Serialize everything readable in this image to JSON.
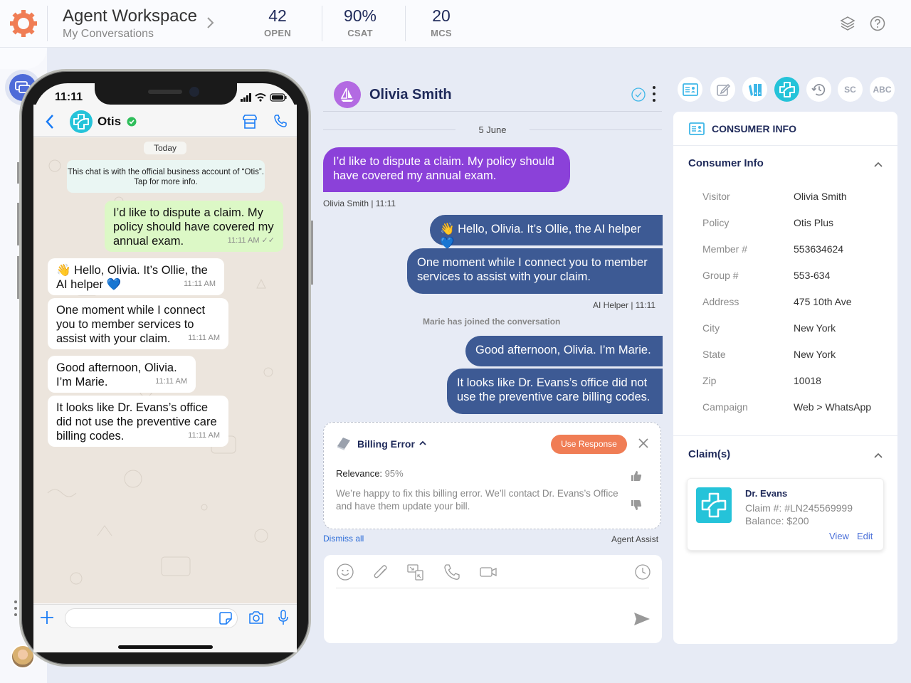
{
  "header": {
    "title": "Agent Workspace",
    "subtitle": "My Conversations",
    "stats": [
      {
        "value": "42",
        "label": "OPEN"
      },
      {
        "value": "90%",
        "label": "CSAT"
      },
      {
        "value": "20",
        "label": "MCS"
      }
    ],
    "icons": [
      "layers-icon",
      "help-icon"
    ]
  },
  "colors": {
    "brand_orange": "#f07d55",
    "customer_bubble": "#8b41d9",
    "agent_bubble": "#3d5a94",
    "accent_teal": "#25c3d9",
    "nav_active": "#4e6bd8"
  },
  "phone": {
    "status_time": "11:11",
    "contact_name": "Otis",
    "date_chip": "Today",
    "business_notice": "This chat is with the official business account of “Otis”. Tap for more info.",
    "messages": [
      {
        "direction": "out",
        "text": "I’d like to dispute a claim. My policy should have covered my annual exam.",
        "time": "11:11 AM ✓✓"
      },
      {
        "direction": "in",
        "text": "👋 Hello, Olivia. It’s Ollie, the AI helper 💙",
        "time": "11:11 AM"
      },
      {
        "direction": "in",
        "text": "One moment while I connect you to member services to assist with your claim.",
        "time": "11:11 AM"
      },
      {
        "direction": "in",
        "text": "Good afternoon, Olivia. I’m Marie.",
        "time": "11:11 AM"
      },
      {
        "direction": "in",
        "text": "It looks like Dr. Evans’s office did not use the preventive care billing codes.",
        "time": "11:11 AM"
      }
    ],
    "input_placeholder": ""
  },
  "conversation": {
    "contact_name": "Olivia Smith",
    "date_divider": "5 June",
    "customer_messages": [
      {
        "text": "I’d like to dispute a claim. My policy should have covered my annual exam."
      }
    ],
    "customer_meta": "Olivia Smith  |  11:11",
    "bot_messages": [
      {
        "text": "👋 Hello, Olivia. It’s Ollie, the AI helper 💙"
      },
      {
        "text": "One moment while I connect you to member services to assist with your claim."
      }
    ],
    "bot_meta": "AI Helper  |  11:11",
    "system_message": "Marie has joined the conversation",
    "agent_messages": [
      {
        "text": "Good afternoon, Olivia. I’m Marie."
      },
      {
        "text": "It looks like Dr. Evans’s office did not use the preventive care billing codes."
      }
    ]
  },
  "agent_assist": {
    "title": "Billing Error",
    "use_response_label": "Use Response",
    "relevance_label": "Relevance:",
    "relevance_value": "95%",
    "suggestion": "We’re happy to fix this billing error. We’ll contact Dr. Evans’s Office and have them update your bill.",
    "dismiss_label": "Dismiss all",
    "section_label": "Agent Assist"
  },
  "composer": {
    "placeholder": "",
    "icons": [
      "emoji-icon",
      "attachment-icon",
      "screen-share-icon",
      "phone-icon",
      "video-icon",
      "clock-icon",
      "send-icon"
    ]
  },
  "right_panel": {
    "tabs": [
      {
        "name": "consumer-info",
        "label": ""
      },
      {
        "name": "notes",
        "label": ""
      },
      {
        "name": "binders",
        "label": ""
      },
      {
        "name": "health",
        "label": "",
        "active": true
      },
      {
        "name": "history",
        "label": ""
      },
      {
        "name": "sc",
        "label": "SC"
      },
      {
        "name": "abc",
        "label": "ABC"
      }
    ],
    "header": "CONSUMER INFO",
    "consumer_section_title": "Consumer Info",
    "consumer_info": [
      {
        "key": "Visitor",
        "value": "Olivia Smith"
      },
      {
        "key": "Policy",
        "value": "Otis Plus"
      },
      {
        "key": "Member #",
        "value": "553634624"
      },
      {
        "key": "Group #",
        "value": "553-634"
      },
      {
        "key": "Address",
        "value": "475 10th Ave"
      },
      {
        "key": "City",
        "value": "New York"
      },
      {
        "key": "State",
        "value": "New York"
      },
      {
        "key": "Zip",
        "value": "10018"
      },
      {
        "key": "Campaign",
        "value": "Web > WhatsApp"
      }
    ],
    "claims_section_title": "Claim(s)",
    "claim": {
      "provider": "Dr. Evans",
      "claim_number": "Claim #: #LN245569999",
      "balance": "Balance: $200",
      "view_label": "View",
      "edit_label": "Edit"
    }
  }
}
